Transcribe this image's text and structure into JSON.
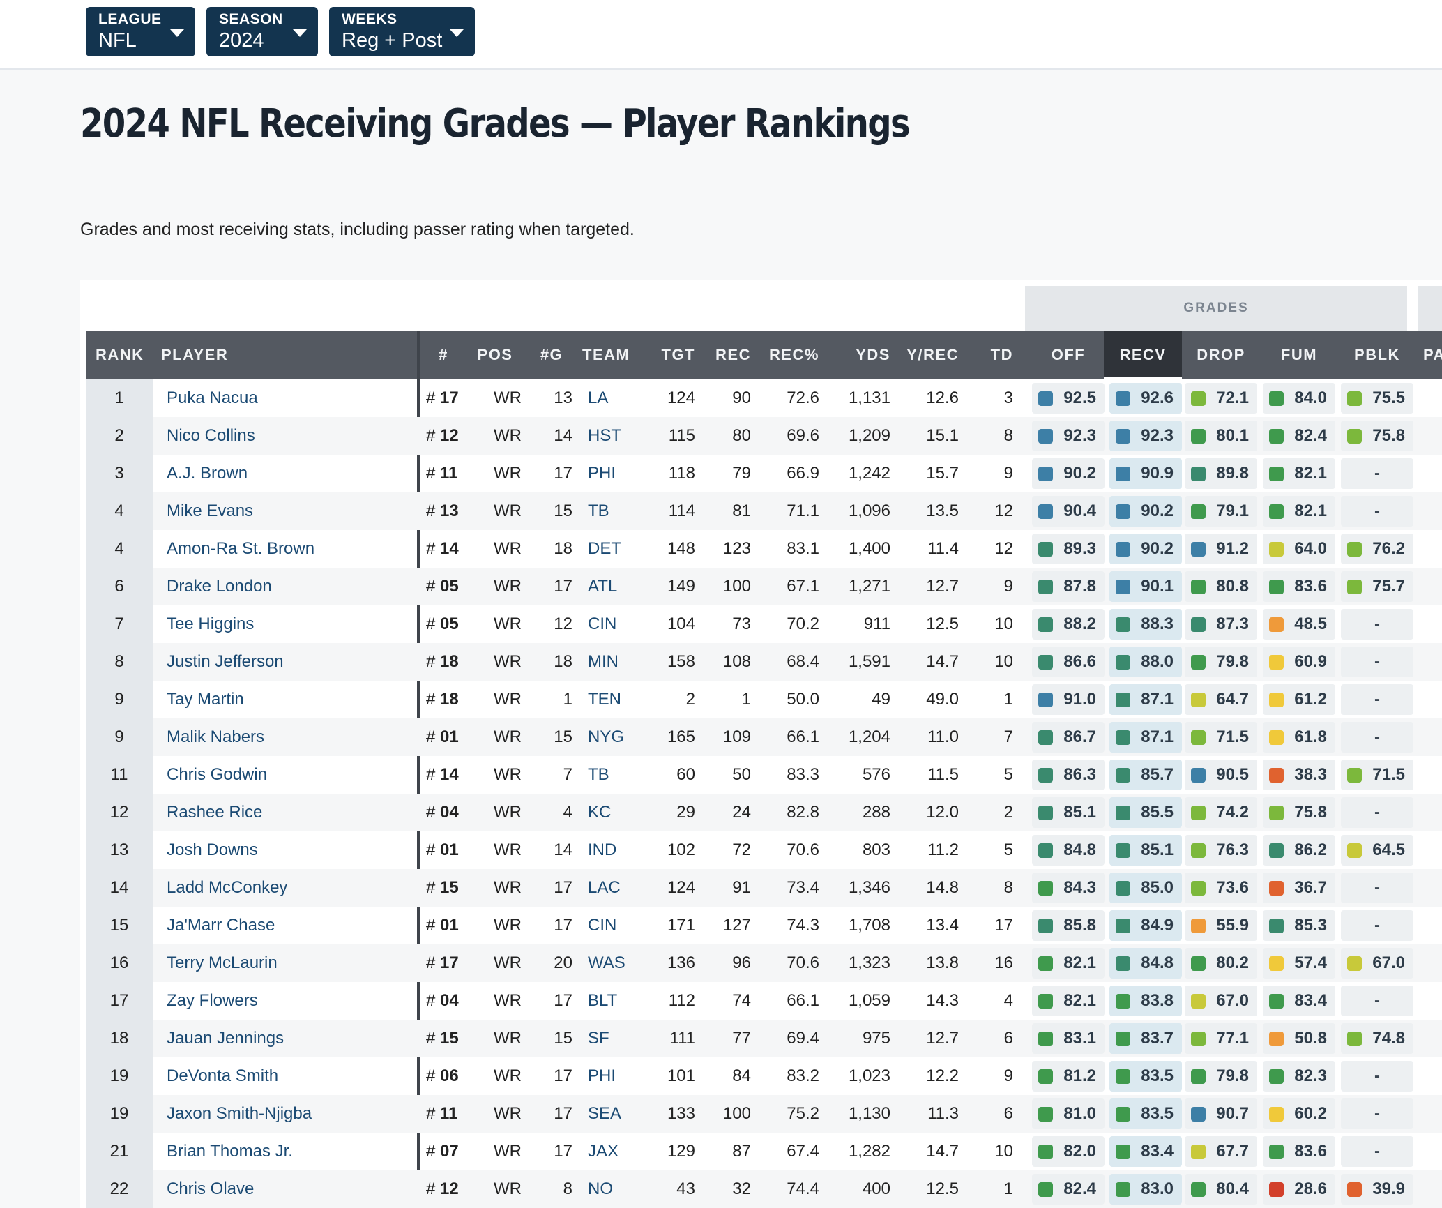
{
  "filters": [
    {
      "label": "LEAGUE",
      "value": "NFL"
    },
    {
      "label": "SEASON",
      "value": "2024"
    },
    {
      "label": "WEEKS",
      "value": "Reg + Post"
    }
  ],
  "page": {
    "title": "2024 NFL Receiving Grades — Player Rankings",
    "subtitle": "Grades and most receiving stats, including passer rating when targeted."
  },
  "table": {
    "group_label": "GRADES",
    "columns": [
      "RANK",
      "PLAYER",
      "#",
      "POS",
      "#G",
      "TEAM",
      "TGT",
      "REC",
      "REC%",
      "YDS",
      "Y/REC",
      "TD",
      "OFF",
      "RECV",
      "DROP",
      "FUM",
      "PBLK",
      "PA"
    ],
    "sorted_column": "RECV",
    "grade_colors": {
      "elite": "#3d7fa6",
      "high": "#3a8a6e",
      "good": "#3f9a4d",
      "above": "#7cb83c",
      "avg": "#c8c93a",
      "below": "#f0c93a",
      "low": "#ef9a3a",
      "poor": "#e0622f",
      "bad": "#d2402b"
    },
    "rows": [
      {
        "rank": "1",
        "player": "Puka Nacua",
        "jersey": "17",
        "pos": "WR",
        "g": "13",
        "team": "LA",
        "tgt": "124",
        "rec": "90",
        "recp": "72.6",
        "yds": "1,131",
        "ypr": "12.6",
        "td": "3",
        "off": "92.5",
        "recv": "92.6",
        "drop": "72.1",
        "fum": "84.0",
        "pblk": "75.5"
      },
      {
        "rank": "2",
        "player": "Nico Collins",
        "jersey": "12",
        "pos": "WR",
        "g": "14",
        "team": "HST",
        "tgt": "115",
        "rec": "80",
        "recp": "69.6",
        "yds": "1,209",
        "ypr": "15.1",
        "td": "8",
        "off": "92.3",
        "recv": "92.3",
        "drop": "80.1",
        "fum": "82.4",
        "pblk": "75.8"
      },
      {
        "rank": "3",
        "player": "A.J. Brown",
        "jersey": "11",
        "pos": "WR",
        "g": "17",
        "team": "PHI",
        "tgt": "118",
        "rec": "79",
        "recp": "66.9",
        "yds": "1,242",
        "ypr": "15.7",
        "td": "9",
        "off": "90.2",
        "recv": "90.9",
        "drop": "89.8",
        "fum": "82.1",
        "pblk": "-"
      },
      {
        "rank": "4",
        "player": "Mike Evans",
        "jersey": "13",
        "pos": "WR",
        "g": "15",
        "team": "TB",
        "tgt": "114",
        "rec": "81",
        "recp": "71.1",
        "yds": "1,096",
        "ypr": "13.5",
        "td": "12",
        "off": "90.4",
        "recv": "90.2",
        "drop": "79.1",
        "fum": "82.1",
        "pblk": "-"
      },
      {
        "rank": "4",
        "player": "Amon-Ra St. Brown",
        "jersey": "14",
        "pos": "WR",
        "g": "18",
        "team": "DET",
        "tgt": "148",
        "rec": "123",
        "recp": "83.1",
        "yds": "1,400",
        "ypr": "11.4",
        "td": "12",
        "off": "89.3",
        "recv": "90.2",
        "drop": "91.2",
        "fum": "64.0",
        "pblk": "76.2"
      },
      {
        "rank": "6",
        "player": "Drake London",
        "jersey": "05",
        "pos": "WR",
        "g": "17",
        "team": "ATL",
        "tgt": "149",
        "rec": "100",
        "recp": "67.1",
        "yds": "1,271",
        "ypr": "12.7",
        "td": "9",
        "off": "87.8",
        "recv": "90.1",
        "drop": "80.8",
        "fum": "83.6",
        "pblk": "75.7"
      },
      {
        "rank": "7",
        "player": "Tee Higgins",
        "jersey": "05",
        "pos": "WR",
        "g": "12",
        "team": "CIN",
        "tgt": "104",
        "rec": "73",
        "recp": "70.2",
        "yds": "911",
        "ypr": "12.5",
        "td": "10",
        "off": "88.2",
        "recv": "88.3",
        "drop": "87.3",
        "fum": "48.5",
        "pblk": "-"
      },
      {
        "rank": "8",
        "player": "Justin Jefferson",
        "jersey": "18",
        "pos": "WR",
        "g": "18",
        "team": "MIN",
        "tgt": "158",
        "rec": "108",
        "recp": "68.4",
        "yds": "1,591",
        "ypr": "14.7",
        "td": "10",
        "off": "86.6",
        "recv": "88.0",
        "drop": "79.8",
        "fum": "60.9",
        "pblk": "-"
      },
      {
        "rank": "9",
        "player": "Tay Martin",
        "jersey": "18",
        "pos": "WR",
        "g": "1",
        "team": "TEN",
        "tgt": "2",
        "rec": "1",
        "recp": "50.0",
        "yds": "49",
        "ypr": "49.0",
        "td": "1",
        "off": "91.0",
        "recv": "87.1",
        "drop": "64.7",
        "fum": "61.2",
        "pblk": "-"
      },
      {
        "rank": "9",
        "player": "Malik Nabers",
        "jersey": "01",
        "pos": "WR",
        "g": "15",
        "team": "NYG",
        "tgt": "165",
        "rec": "109",
        "recp": "66.1",
        "yds": "1,204",
        "ypr": "11.0",
        "td": "7",
        "off": "86.7",
        "recv": "87.1",
        "drop": "71.5",
        "fum": "61.8",
        "pblk": "-"
      },
      {
        "rank": "11",
        "player": "Chris Godwin",
        "jersey": "14",
        "pos": "WR",
        "g": "7",
        "team": "TB",
        "tgt": "60",
        "rec": "50",
        "recp": "83.3",
        "yds": "576",
        "ypr": "11.5",
        "td": "5",
        "off": "86.3",
        "recv": "85.7",
        "drop": "90.5",
        "fum": "38.3",
        "pblk": "71.5"
      },
      {
        "rank": "12",
        "player": "Rashee Rice",
        "jersey": "04",
        "pos": "WR",
        "g": "4",
        "team": "KC",
        "tgt": "29",
        "rec": "24",
        "recp": "82.8",
        "yds": "288",
        "ypr": "12.0",
        "td": "2",
        "off": "85.1",
        "recv": "85.5",
        "drop": "74.2",
        "fum": "75.8",
        "pblk": "-"
      },
      {
        "rank": "13",
        "player": "Josh Downs",
        "jersey": "01",
        "pos": "WR",
        "g": "14",
        "team": "IND",
        "tgt": "102",
        "rec": "72",
        "recp": "70.6",
        "yds": "803",
        "ypr": "11.2",
        "td": "5",
        "off": "84.8",
        "recv": "85.1",
        "drop": "76.3",
        "fum": "86.2",
        "pblk": "64.5"
      },
      {
        "rank": "14",
        "player": "Ladd McConkey",
        "jersey": "15",
        "pos": "WR",
        "g": "17",
        "team": "LAC",
        "tgt": "124",
        "rec": "91",
        "recp": "73.4",
        "yds": "1,346",
        "ypr": "14.8",
        "td": "8",
        "off": "84.3",
        "recv": "85.0",
        "drop": "73.6",
        "fum": "36.7",
        "pblk": "-"
      },
      {
        "rank": "15",
        "player": "Ja'Marr Chase",
        "jersey": "01",
        "pos": "WR",
        "g": "17",
        "team": "CIN",
        "tgt": "171",
        "rec": "127",
        "recp": "74.3",
        "yds": "1,708",
        "ypr": "13.4",
        "td": "17",
        "off": "85.8",
        "recv": "84.9",
        "drop": "55.9",
        "fum": "85.3",
        "pblk": "-"
      },
      {
        "rank": "16",
        "player": "Terry McLaurin",
        "jersey": "17",
        "pos": "WR",
        "g": "20",
        "team": "WAS",
        "tgt": "136",
        "rec": "96",
        "recp": "70.6",
        "yds": "1,323",
        "ypr": "13.8",
        "td": "16",
        "off": "82.1",
        "recv": "84.8",
        "drop": "80.2",
        "fum": "57.4",
        "pblk": "67.0"
      },
      {
        "rank": "17",
        "player": "Zay Flowers",
        "jersey": "04",
        "pos": "WR",
        "g": "17",
        "team": "BLT",
        "tgt": "112",
        "rec": "74",
        "recp": "66.1",
        "yds": "1,059",
        "ypr": "14.3",
        "td": "4",
        "off": "82.1",
        "recv": "83.8",
        "drop": "67.0",
        "fum": "83.4",
        "pblk": "-"
      },
      {
        "rank": "18",
        "player": "Jauan Jennings",
        "jersey": "15",
        "pos": "WR",
        "g": "15",
        "team": "SF",
        "tgt": "111",
        "rec": "77",
        "recp": "69.4",
        "yds": "975",
        "ypr": "12.7",
        "td": "6",
        "off": "83.1",
        "recv": "83.7",
        "drop": "77.1",
        "fum": "50.8",
        "pblk": "74.8"
      },
      {
        "rank": "19",
        "player": "DeVonta Smith",
        "jersey": "06",
        "pos": "WR",
        "g": "17",
        "team": "PHI",
        "tgt": "101",
        "rec": "84",
        "recp": "83.2",
        "yds": "1,023",
        "ypr": "12.2",
        "td": "9",
        "off": "81.2",
        "recv": "83.5",
        "drop": "79.8",
        "fum": "82.3",
        "pblk": "-"
      },
      {
        "rank": "19",
        "player": "Jaxon Smith-Njigba",
        "jersey": "11",
        "pos": "WR",
        "g": "17",
        "team": "SEA",
        "tgt": "133",
        "rec": "100",
        "recp": "75.2",
        "yds": "1,130",
        "ypr": "11.3",
        "td": "6",
        "off": "81.0",
        "recv": "83.5",
        "drop": "90.7",
        "fum": "60.2",
        "pblk": "-"
      },
      {
        "rank": "21",
        "player": "Brian Thomas Jr.",
        "jersey": "07",
        "pos": "WR",
        "g": "17",
        "team": "JAX",
        "tgt": "129",
        "rec": "87",
        "recp": "67.4",
        "yds": "1,282",
        "ypr": "14.7",
        "td": "10",
        "off": "82.0",
        "recv": "83.4",
        "drop": "67.7",
        "fum": "83.6",
        "pblk": "-"
      },
      {
        "rank": "22",
        "player": "Chris Olave",
        "jersey": "12",
        "pos": "WR",
        "g": "8",
        "team": "NO",
        "tgt": "43",
        "rec": "32",
        "recp": "74.4",
        "yds": "400",
        "ypr": "12.5",
        "td": "1",
        "off": "82.4",
        "recv": "83.0",
        "drop": "80.4",
        "fum": "28.6",
        "pblk": "39.9"
      }
    ]
  }
}
